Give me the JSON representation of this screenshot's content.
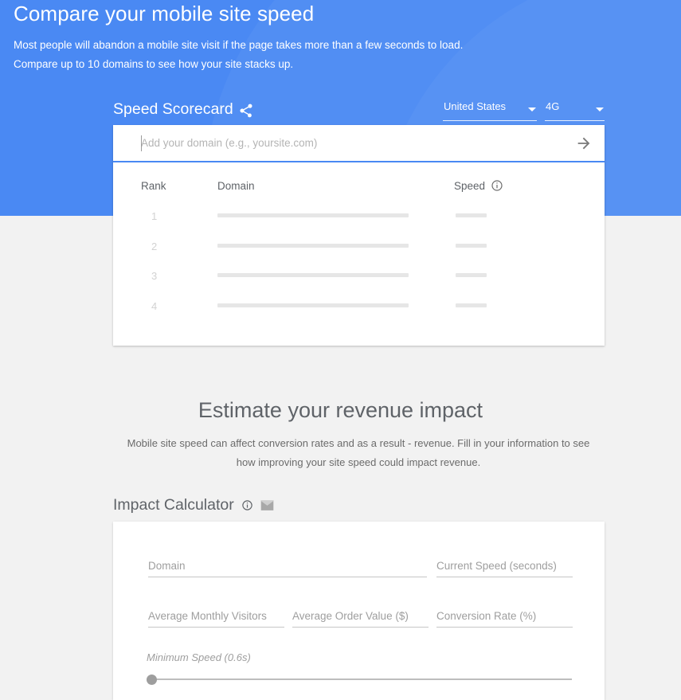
{
  "hero": {
    "title": "Compare your mobile site speed",
    "subtitle": "Most people will abandon a mobile site visit if the page takes more than a few seconds to load. Compare up to 10 domains to see how your site stacks up."
  },
  "scorecard": {
    "title": "Speed Scorecard",
    "share_icon": "share-icon",
    "country_dropdown": {
      "value": "United States",
      "icon": "chevron-down-icon"
    },
    "network_dropdown": {
      "value": "4G",
      "icon": "chevron-down-icon"
    },
    "search": {
      "placeholder": "Add your domain (e.g., yoursite.com)",
      "value": "",
      "submit_icon": "arrow-right-icon"
    },
    "table": {
      "columns": [
        "Rank",
        "Domain",
        "Speed"
      ],
      "speed_info_icon": "info-icon",
      "rows": [
        {
          "rank": "1",
          "domain": "",
          "speed": ""
        },
        {
          "rank": "2",
          "domain": "",
          "speed": ""
        },
        {
          "rank": "3",
          "domain": "",
          "speed": ""
        },
        {
          "rank": "4",
          "domain": "",
          "speed": ""
        }
      ]
    }
  },
  "revenue": {
    "heading": "Estimate your revenue impact",
    "description": "Mobile site speed can affect conversion rates and as a result - revenue. Fill in your information to see how improving your site speed could impact revenue."
  },
  "calculator": {
    "title": "Impact Calculator",
    "info_icon": "info-icon",
    "email_icon": "email-icon",
    "fields": {
      "domain": {
        "placeholder": "Domain",
        "value": ""
      },
      "current_speed": {
        "placeholder": "Current Speed (seconds)",
        "value": ""
      },
      "visitors": {
        "placeholder": "Average Monthly Visitors",
        "value": ""
      },
      "order_value": {
        "placeholder": "Average Order Value ($)",
        "value": ""
      },
      "conversion_rate": {
        "placeholder": "Conversion Rate (%)",
        "value": ""
      }
    },
    "slider": {
      "label": "Minimum Speed (0.6s)",
      "value": "0.6",
      "position_percent": 0
    }
  },
  "colors": {
    "brand_blue": "#4a89f3",
    "page_background": "#f2f2f2",
    "card_background": "#ffffff",
    "text_gray": "#5f6368",
    "skeleton_gray": "#e6e6e6"
  }
}
